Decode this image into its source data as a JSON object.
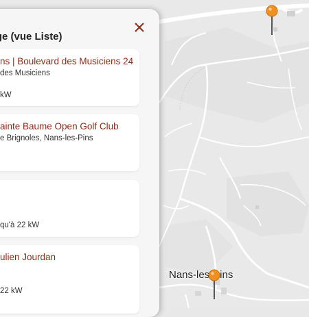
{
  "panel": {
    "title": "rge (vue Liste)",
    "close_icon": "close-icon",
    "accent": "#8a2b17"
  },
  "stations": [
    {
      "name": "ns | Boulevard des Musiciens 24",
      "address": "des Musiciens",
      "power": "kW"
    },
    {
      "name": "ainte Baume Open Golf Club",
      "address": "e Brignoles, Nans-les-Pins",
      "power": ""
    },
    {
      "name": "",
      "address": "",
      "power": "qu'à 22 kW"
    },
    {
      "name": "ulien Jourdan",
      "address": "",
      "power": "22 kW"
    }
  ],
  "map": {
    "place_label": "Nans-les-Pins",
    "pin_color": "#f0901e",
    "pin_icon": "map-pin-icon"
  }
}
